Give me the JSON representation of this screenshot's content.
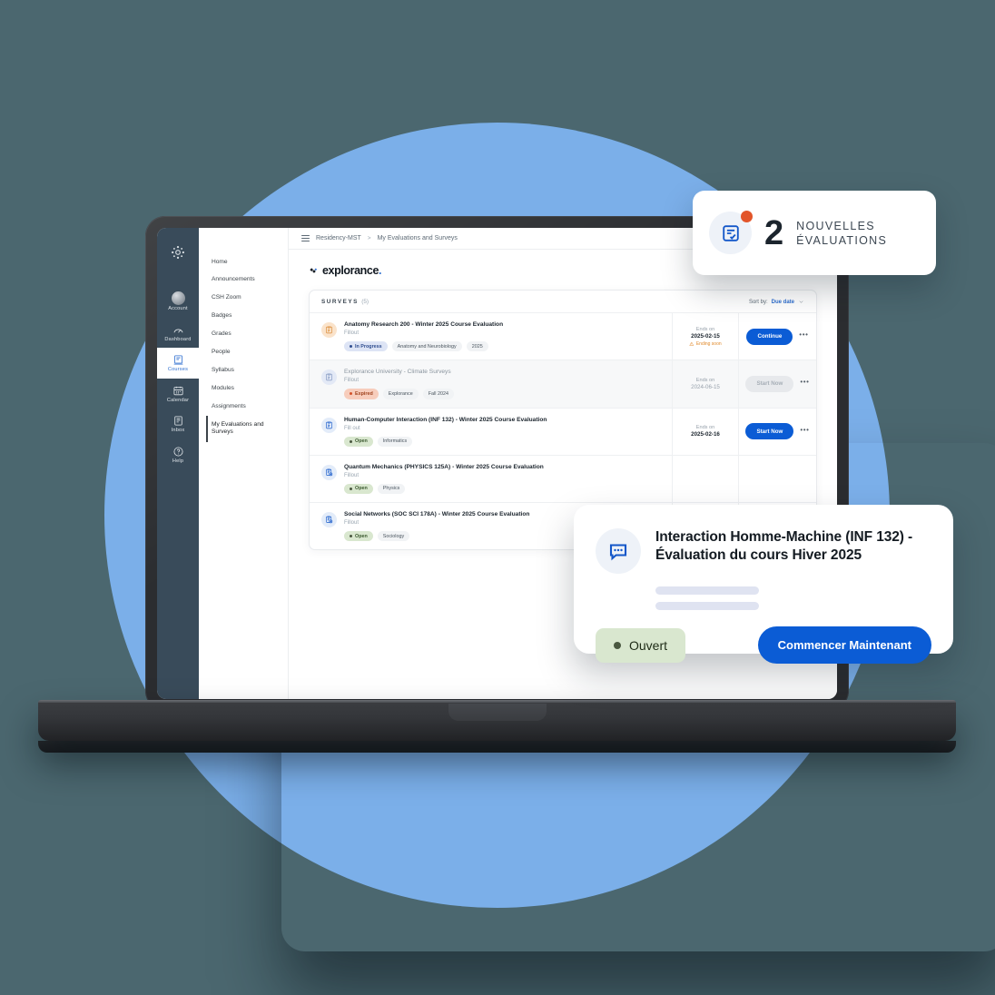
{
  "background": {
    "page_color": "#4b676f",
    "circle_color": "#7bafe9",
    "accent_blue": "#0b5cd5"
  },
  "global_nav": {
    "logo_icon": "canvas-logo-icon",
    "items": [
      {
        "label": "Account",
        "icon": "avatar-icon",
        "active": false
      },
      {
        "label": "Dashboard",
        "icon": "dashboard-icon",
        "active": false
      },
      {
        "label": "Courses",
        "icon": "courses-icon",
        "active": true
      },
      {
        "label": "Calendar",
        "icon": "calendar-icon",
        "active": false
      },
      {
        "label": "Inbox",
        "icon": "inbox-icon",
        "active": false
      },
      {
        "label": "Help",
        "icon": "help-icon",
        "active": false
      }
    ]
  },
  "course_nav": {
    "items": [
      {
        "label": "Home",
        "active": false
      },
      {
        "label": "Announcements",
        "active": false
      },
      {
        "label": "CSH Zoom",
        "active": false
      },
      {
        "label": "Badges",
        "active": false
      },
      {
        "label": "Grades",
        "active": false
      },
      {
        "label": "People",
        "active": false
      },
      {
        "label": "Syllabus",
        "active": false
      },
      {
        "label": "Modules",
        "active": false
      },
      {
        "label": "Assignments",
        "active": false
      },
      {
        "label": "My Evaluations and Surveys",
        "active": true
      }
    ]
  },
  "topbar": {
    "menu_icon": "hamburger-icon",
    "breadcrumb_course": "Residency-MST",
    "breadcrumb_separator": ">",
    "breadcrumb_page": "My Evaluations and Surveys"
  },
  "brand": {
    "name": "explorance",
    "dot": ".",
    "logo_icon": "explorance-diamond-icon"
  },
  "surveys_card": {
    "title": "SURVEYS",
    "count": "(5)",
    "sort_label": "Sort by:",
    "sort_value": "Due date",
    "sort_icon": "chevron-down-icon",
    "kebab_icon": "more-options-icon",
    "rows": [
      {
        "name": "Anatomy Research 200 - Winter 2025 Course Evaluation",
        "subtitle": "Fillout",
        "icon": "clipboard-check-icon",
        "icon_bg": "#fae3cb",
        "icon_stroke": "#d8862f",
        "status": "In Progress",
        "status_class": "inprogress",
        "status_dot": "#2f4d8f",
        "tags": [
          "Anatomy and Neurobiology",
          "2025"
        ],
        "date_label": "Ends on",
        "date_value": "2025-02-15",
        "warning": "Ending soon",
        "warning_icon": "warning-triangle-icon",
        "action": "Continue",
        "action_disabled": false,
        "muted": false
      },
      {
        "name": "Explorance University - Climate Surveys",
        "subtitle": "Fillout",
        "icon": "clipboard-check-icon",
        "icon_bg": "#e3e9f6",
        "icon_stroke": "#7e93bd",
        "status": "Expired",
        "status_class": "expired",
        "status_dot": "#d4522a",
        "tags": [
          "Explorance",
          "Fall 2024"
        ],
        "date_label": "Ends on",
        "date_value": "2024-06-15",
        "warning": "",
        "action": "Start Now",
        "action_disabled": true,
        "muted": true
      },
      {
        "name": "Human-Computer Interaction (INF 132) - Winter 2025 Course Evaluation",
        "subtitle": "Fill out",
        "icon": "clipboard-check-icon",
        "icon_bg": "#e3ecf9",
        "icon_stroke": "#1357c9",
        "status": "Open",
        "status_class": "open",
        "status_dot": "#4a5840",
        "tags": [
          "Informatics"
        ],
        "date_label": "Ends on",
        "date_value": "2025-02-16",
        "warning": "",
        "action": "Start Now",
        "action_disabled": false,
        "muted": false
      },
      {
        "name": "Quantum Mechanics (PHYSICS 125A) - Winter 2025 Course Evaluation",
        "subtitle": "Fillout",
        "icon": "clipboard-add-icon",
        "icon_bg": "#e3ecf9",
        "icon_stroke": "#1357c9",
        "status": "Open",
        "status_class": "open",
        "status_dot": "#4a5840",
        "tags": [
          "Physics"
        ],
        "date_label": "",
        "date_value": "",
        "warning": "",
        "action": "",
        "action_disabled": false,
        "muted": false
      },
      {
        "name": "Social Networks (SOC SCI 178A) - Winter 2025 Course Evaluation",
        "subtitle": "Fillout",
        "icon": "clipboard-add-icon",
        "icon_bg": "#e3ecf9",
        "icon_stroke": "#1357c9",
        "status": "Open",
        "status_class": "open",
        "status_dot": "#4a5840",
        "tags": [
          "Sociology"
        ],
        "date_label": "",
        "date_value": "",
        "warning": "",
        "action": "",
        "action_disabled": false,
        "muted": false
      }
    ]
  },
  "float_top_card": {
    "icon": "survey-checklist-icon",
    "badge_icon": "notification-dot",
    "count": "2",
    "line1": "NOUVELLES",
    "line2": "ÉVALUATIONS"
  },
  "float_bottom_card": {
    "icon": "chat-bubble-icon",
    "title_line1": "Interaction Homme-Machine (INF 132) -",
    "title_line2": "Évaluation du cours Hiver 2025",
    "status": "Ouvert",
    "status_dot_color": "#4a5840",
    "button": "Commencer Maintenant"
  }
}
